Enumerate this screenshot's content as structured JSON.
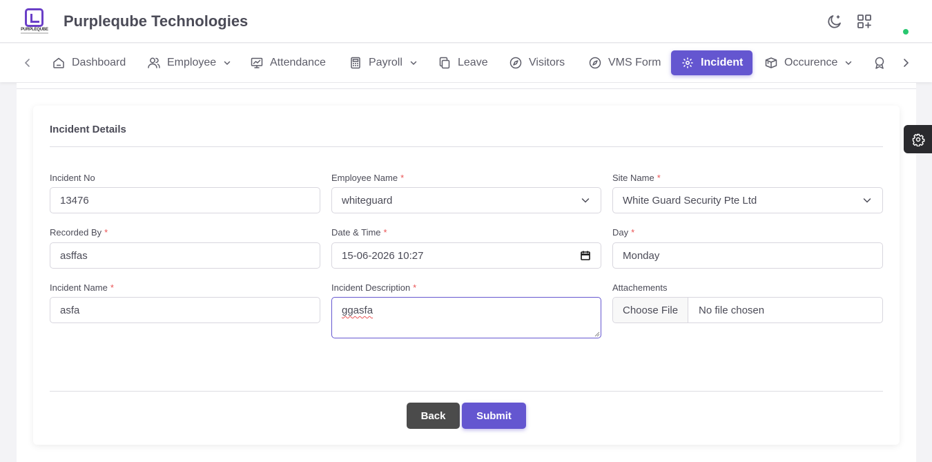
{
  "app": {
    "brand_text": "PURPLEQUBE",
    "title": "Purpleqube Technologies"
  },
  "nav": {
    "items": [
      {
        "label": "Dashboard",
        "icon": "home-icon"
      },
      {
        "label": "Employee",
        "icon": "users-icon",
        "dropdown": true
      },
      {
        "label": "Attendance",
        "icon": "presentation-chart-icon"
      },
      {
        "label": "Payroll",
        "icon": "calculator-icon",
        "dropdown": true
      },
      {
        "label": "Leave",
        "icon": "copy-icon"
      },
      {
        "label": "Visitors",
        "icon": "compass-icon"
      },
      {
        "label": "VMS Form",
        "icon": "compass-icon"
      },
      {
        "label": "Incident",
        "icon": "focus-icon",
        "active": true
      },
      {
        "label": "Occurence",
        "icon": "box-icon",
        "dropdown": true
      },
      {
        "label": "",
        "icon": "award-icon"
      }
    ]
  },
  "form": {
    "title": "Incident Details",
    "incident_no": {
      "label": "Incident No",
      "value": "13476"
    },
    "employee_name": {
      "label": "Employee Name",
      "value": "whiteguard",
      "required": "*"
    },
    "site_name": {
      "label": "Site Name",
      "value": "White Guard Security Pte Ltd",
      "required": "*"
    },
    "recorded_by": {
      "label": "Recorded By",
      "value": "asffas",
      "required": "*"
    },
    "date_time": {
      "label": "Date & Time",
      "value": "15-06-2026 10:27",
      "required": "*"
    },
    "day": {
      "label": "Day",
      "value": "Monday",
      "required": "*"
    },
    "incident_name": {
      "label": "Incident Name",
      "value": "asfa",
      "required": "*"
    },
    "incident_description": {
      "label": "Incident Description",
      "value": "ggasfa",
      "required": "*"
    },
    "attachments": {
      "label": "Attachements",
      "button": "Choose File",
      "status": "No file chosen"
    }
  },
  "buttons": {
    "back": "Back",
    "submit": "Submit"
  },
  "colors": {
    "accent": "#6456d0",
    "required": "#ea5455",
    "online": "#28c76f",
    "dark": "#4b4b4b"
  }
}
